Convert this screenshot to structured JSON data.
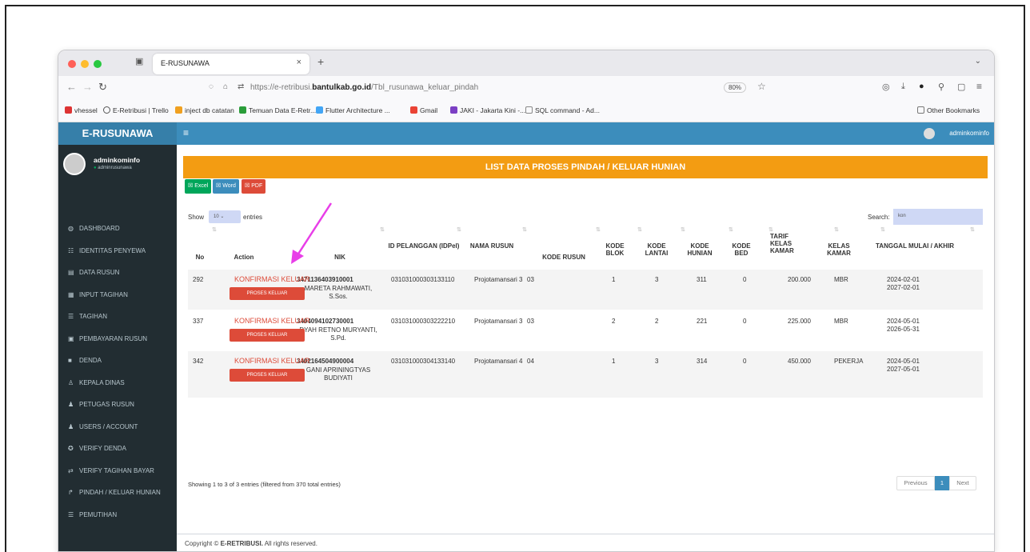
{
  "browser": {
    "tab_title": "E-RUSUNAWA",
    "url_prefix": "https://e-retribusi.",
    "url_domain": "bantulkab.go.id",
    "url_path": "/Tbl_rusunawa_keluar_pindah",
    "zoom": "80%",
    "bookmarks": [
      "vhessel",
      "E-Retribusi | Trello",
      "inject db catatan",
      "Temuan Data E-Retr...",
      "Flutter Architecture ...",
      "Gmail",
      "JAKI - Jakarta Kini -...",
      "SQL command - Ad..."
    ],
    "other_bookmarks": "Other Bookmarks"
  },
  "app": {
    "logo": "E-RUSUNAWA",
    "menu_toggle": "≡",
    "top_user": "adminkominfo",
    "profile": {
      "name": "adminkominfo",
      "role": "adminrusunawa"
    },
    "sidebar": [
      {
        "label": "DASHBOARD",
        "icon": "dashboard-icon",
        "glyph": "◍"
      },
      {
        "label": "IDENTITAS PENYEWA",
        "icon": "users-icon",
        "glyph": "☷"
      },
      {
        "label": "DATA RUSUN",
        "icon": "building-icon",
        "glyph": "▤"
      },
      {
        "label": "INPUT TAGIHAN",
        "icon": "invoice-icon",
        "glyph": "▦"
      },
      {
        "label": "TAGIHAN",
        "icon": "list-icon",
        "glyph": "☰"
      },
      {
        "label": "PEMBAYARAN RUSUN",
        "icon": "payment-icon",
        "glyph": "▣"
      },
      {
        "label": "DENDA",
        "icon": "fine-icon",
        "glyph": "■"
      },
      {
        "label": "KEPALA DINAS",
        "icon": "head-icon",
        "glyph": "♙"
      },
      {
        "label": "PETUGAS RUSUN",
        "icon": "staff-icon",
        "glyph": "♟"
      },
      {
        "label": "USERS / ACCOUNT",
        "icon": "account-icon",
        "glyph": "♟"
      },
      {
        "label": "VERIFY DENDA",
        "icon": "verify-icon",
        "glyph": "✪"
      },
      {
        "label": "VERIFY TAGIHAN BAYAR",
        "icon": "verify-bill-icon",
        "glyph": "⇄"
      },
      {
        "label": "PINDAH / KELUAR HUNIAN",
        "icon": "move-icon",
        "glyph": "↱"
      },
      {
        "label": "PEMUTIHAN",
        "icon": "whitening-icon",
        "glyph": "☰"
      }
    ]
  },
  "page": {
    "title": "LIST DATA PROSES PINDAH / KELUAR HUNIAN",
    "export_buttons": [
      "Excel",
      "Word",
      "PDF"
    ],
    "show_label": "Show",
    "entries_value": "10",
    "entries_label": "entries",
    "search_label": "Search:",
    "search_value": "kon",
    "columns": [
      "No",
      "Action",
      "NIK",
      "ID PELANGGAN (IDPel)",
      "NAMA RUSUN",
      "KODE RUSUN",
      "KODE BLOK",
      "KODE LANTAI",
      "KODE HUNIAN",
      "KODE BED",
      "TARIF KELAS KAMAR",
      "KELAS KAMAR",
      "TANGGAL MULAI / AKHIR"
    ],
    "rows": [
      {
        "no": "292",
        "action1": "KONFIRMASI KELUAR",
        "action2": "PROSES KELUAR",
        "nik": "3471136403910001",
        "name": "MARETA RAHMAWATI, S.Sos.",
        "idpel": "031031000303133110",
        "rusun": "Projotamansari 3",
        "kode_rusun": "03",
        "blok": "1",
        "lantai": "3",
        "hunian": "311",
        "bed": "0",
        "tarif": "200.000",
        "kelas": "MBR",
        "mulai": "2024-02-01",
        "akhir": "2027-02-01"
      },
      {
        "no": "337",
        "action1": "KONFIRMASI KELUAR",
        "action2": "PROSES KELUAR",
        "nik": "3404094102730001",
        "name": "DYAH RETNO MURYANTI, S.Pd.",
        "idpel": "031031000303222210",
        "rusun": "Projotamansari 3",
        "kode_rusun": "03",
        "blok": "2",
        "lantai": "2",
        "hunian": "221",
        "bed": "0",
        "tarif": "225.000",
        "kelas": "MBR",
        "mulai": "2024-05-01",
        "akhir": "2026-05-31"
      },
      {
        "no": "342",
        "action1": "KONFIRMASI KELUAR",
        "action2": "PROSES KELUAR",
        "nik": "3402164504900004",
        "name": "GANI APRININGTYAS BUDIYATI",
        "idpel": "031031000304133140",
        "rusun": "Projotamansari 4",
        "kode_rusun": "04",
        "blok": "1",
        "lantai": "3",
        "hunian": "314",
        "bed": "0",
        "tarif": "450.000",
        "kelas": "PEKERJA",
        "mulai": "2024-05-01",
        "akhir": "2027-05-01"
      }
    ],
    "info": "Showing 1 to 3 of 3 entries (filtered from 370 total entries)",
    "pagination": {
      "prev": "Previous",
      "current": "1",
      "next": "Next"
    },
    "footer_prefix": "Copyright © ",
    "footer_brand": "E-RETRIBUSI.",
    "footer_suffix": " All rights reserved."
  },
  "colors": {
    "brand": "#3c8dbc",
    "title": "#f39c12",
    "danger": "#dd4b39",
    "sidebar": "#222d32",
    "annotation": "#e83ee8"
  }
}
